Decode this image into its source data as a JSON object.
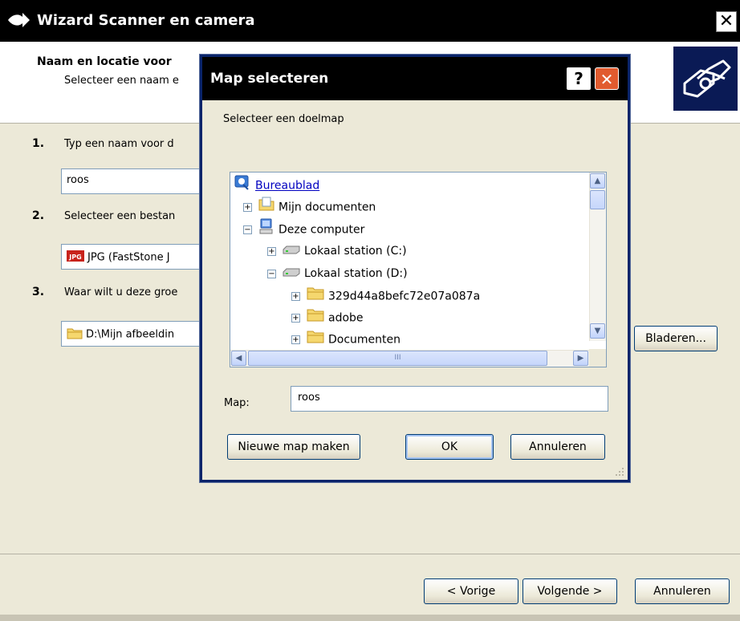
{
  "wizard": {
    "title": "Wizard Scanner en camera",
    "close_glyph": "✕",
    "header_title": "Naam en locatie voor",
    "header_subtitle": "Selecteer een naam e",
    "steps": [
      {
        "num": "1.",
        "text": "Typ een naam voor d"
      },
      {
        "num": "2.",
        "text": "Selecteer een bestan"
      },
      {
        "num": "3.",
        "text": "Waar wilt u deze groe"
      }
    ],
    "name_value": "roos",
    "format_value": "JPG (FastStone J",
    "format_icon_text": "JPG",
    "location_value": "D:\\Mijn afbeeldin",
    "browse_button": "Bladeren...",
    "back_button": "< Vorige",
    "next_button": "Volgende >",
    "cancel_button": "Annuleren"
  },
  "dialog": {
    "title": "Map selecteren",
    "help_glyph": "?",
    "close_glyph": "✕",
    "prompt": "Selecteer een doelmap",
    "tree": [
      {
        "label": "Bureaublad",
        "icon": "desktop-icon",
        "expander": "",
        "level": 0,
        "link": true
      },
      {
        "label": "Mijn documenten",
        "icon": "my-documents-icon",
        "expander": "+",
        "level": 1
      },
      {
        "label": "Deze computer",
        "icon": "computer-icon",
        "expander": "−",
        "level": 1
      },
      {
        "label": "Lokaal station (C:)",
        "icon": "drive-icon",
        "expander": "+",
        "level": 2
      },
      {
        "label": "Lokaal station (D:)",
        "icon": "drive-icon",
        "expander": "−",
        "level": 2
      },
      {
        "label": "329d44a8befc72e07a087a",
        "icon": "folder-icon",
        "expander": "+",
        "level": 3
      },
      {
        "label": "adobe",
        "icon": "folder-icon",
        "expander": "+",
        "level": 3
      },
      {
        "label": "Documenten",
        "icon": "folder-icon",
        "expander": "+",
        "level": 3
      }
    ],
    "hscroll_grip": "III",
    "map_label": "Map:",
    "map_value": "roos",
    "new_folder_button": "Nieuwe map maken",
    "ok_button": "OK",
    "cancel_button": "Annuleren"
  }
}
